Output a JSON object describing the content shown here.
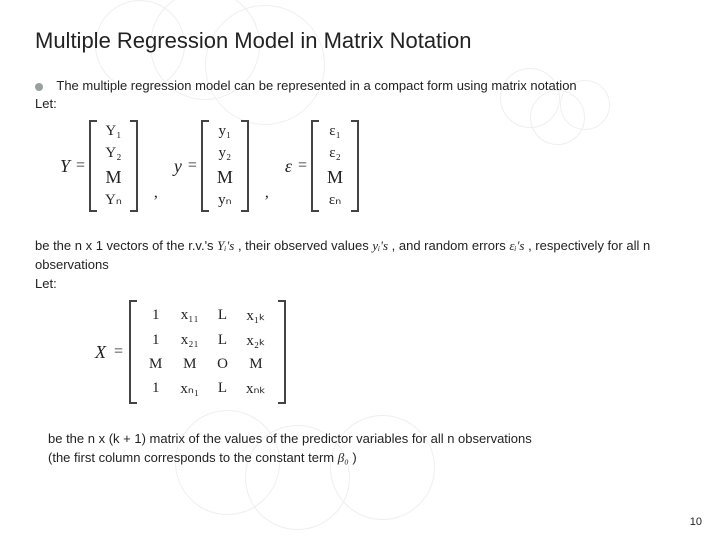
{
  "title": "Multiple Regression Model in Matrix Notation",
  "intro": "The multiple regression model can be represented in a compact form using matrix notation",
  "let1": "Let:",
  "matrices1": {
    "Y": {
      "lhs": "Y",
      "rows": [
        "Y₁",
        "Y₂",
        "M",
        "Yₙ"
      ]
    },
    "y": {
      "lhs": "y",
      "rows": [
        "y₁",
        "y₂",
        "M",
        "yₙ"
      ]
    },
    "eps": {
      "lhs": "ε",
      "rows": [
        "ε₁",
        "ε₂",
        "M",
        "εₙ"
      ]
    }
  },
  "para1": {
    "a": "be the n x 1 vectors of the r.v.'s ",
    "Yi": "Yᵢ's",
    "b": " , their observed values ",
    "yi": "yᵢ's",
    "c": " , and random errors ",
    "ei": "εᵢ's",
    "d": " , respectively for all n observations",
    "let2": "Let:"
  },
  "matrices2": {
    "lhs": "X",
    "rows": [
      [
        "1",
        "x₁₁",
        "L",
        "x₁ₖ"
      ],
      [
        "1",
        "x₂₁",
        "L",
        "x₂ₖ"
      ],
      [
        "M",
        "M",
        "O",
        "M"
      ],
      [
        "1",
        "xₙ₁",
        "L",
        "xₙₖ"
      ]
    ]
  },
  "para2": {
    "a": "be the n x (k + 1) matrix of the values of the predictor variables for all n observations",
    "b": "(the first column corresponds to the constant term ",
    "beta0": "β₀",
    "c": " )"
  },
  "page": "10"
}
